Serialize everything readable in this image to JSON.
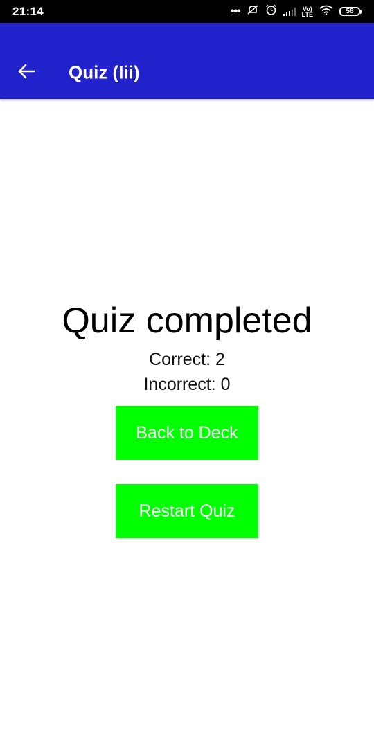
{
  "status_bar": {
    "time": "21:14",
    "battery": "58",
    "icons": [
      "more-dots-icon",
      "notifications-off-icon",
      "alarm-icon",
      "signal-icon",
      "volte-icon",
      "wifi-icon",
      "battery-icon"
    ],
    "volte_top": "Vo)",
    "volte_bottom": "LTE"
  },
  "app_bar": {
    "title": "Quiz (Iii)",
    "color": "#2222cc",
    "back_icon": "arrow-left-icon"
  },
  "result": {
    "heading": "Quiz completed",
    "correct": "Correct: 2",
    "incorrect": "Incorrect: 0"
  },
  "actions": {
    "back_to_deck": "Back to Deck",
    "restart_quiz": "Restart Quiz",
    "button_color": "#00ff00"
  }
}
